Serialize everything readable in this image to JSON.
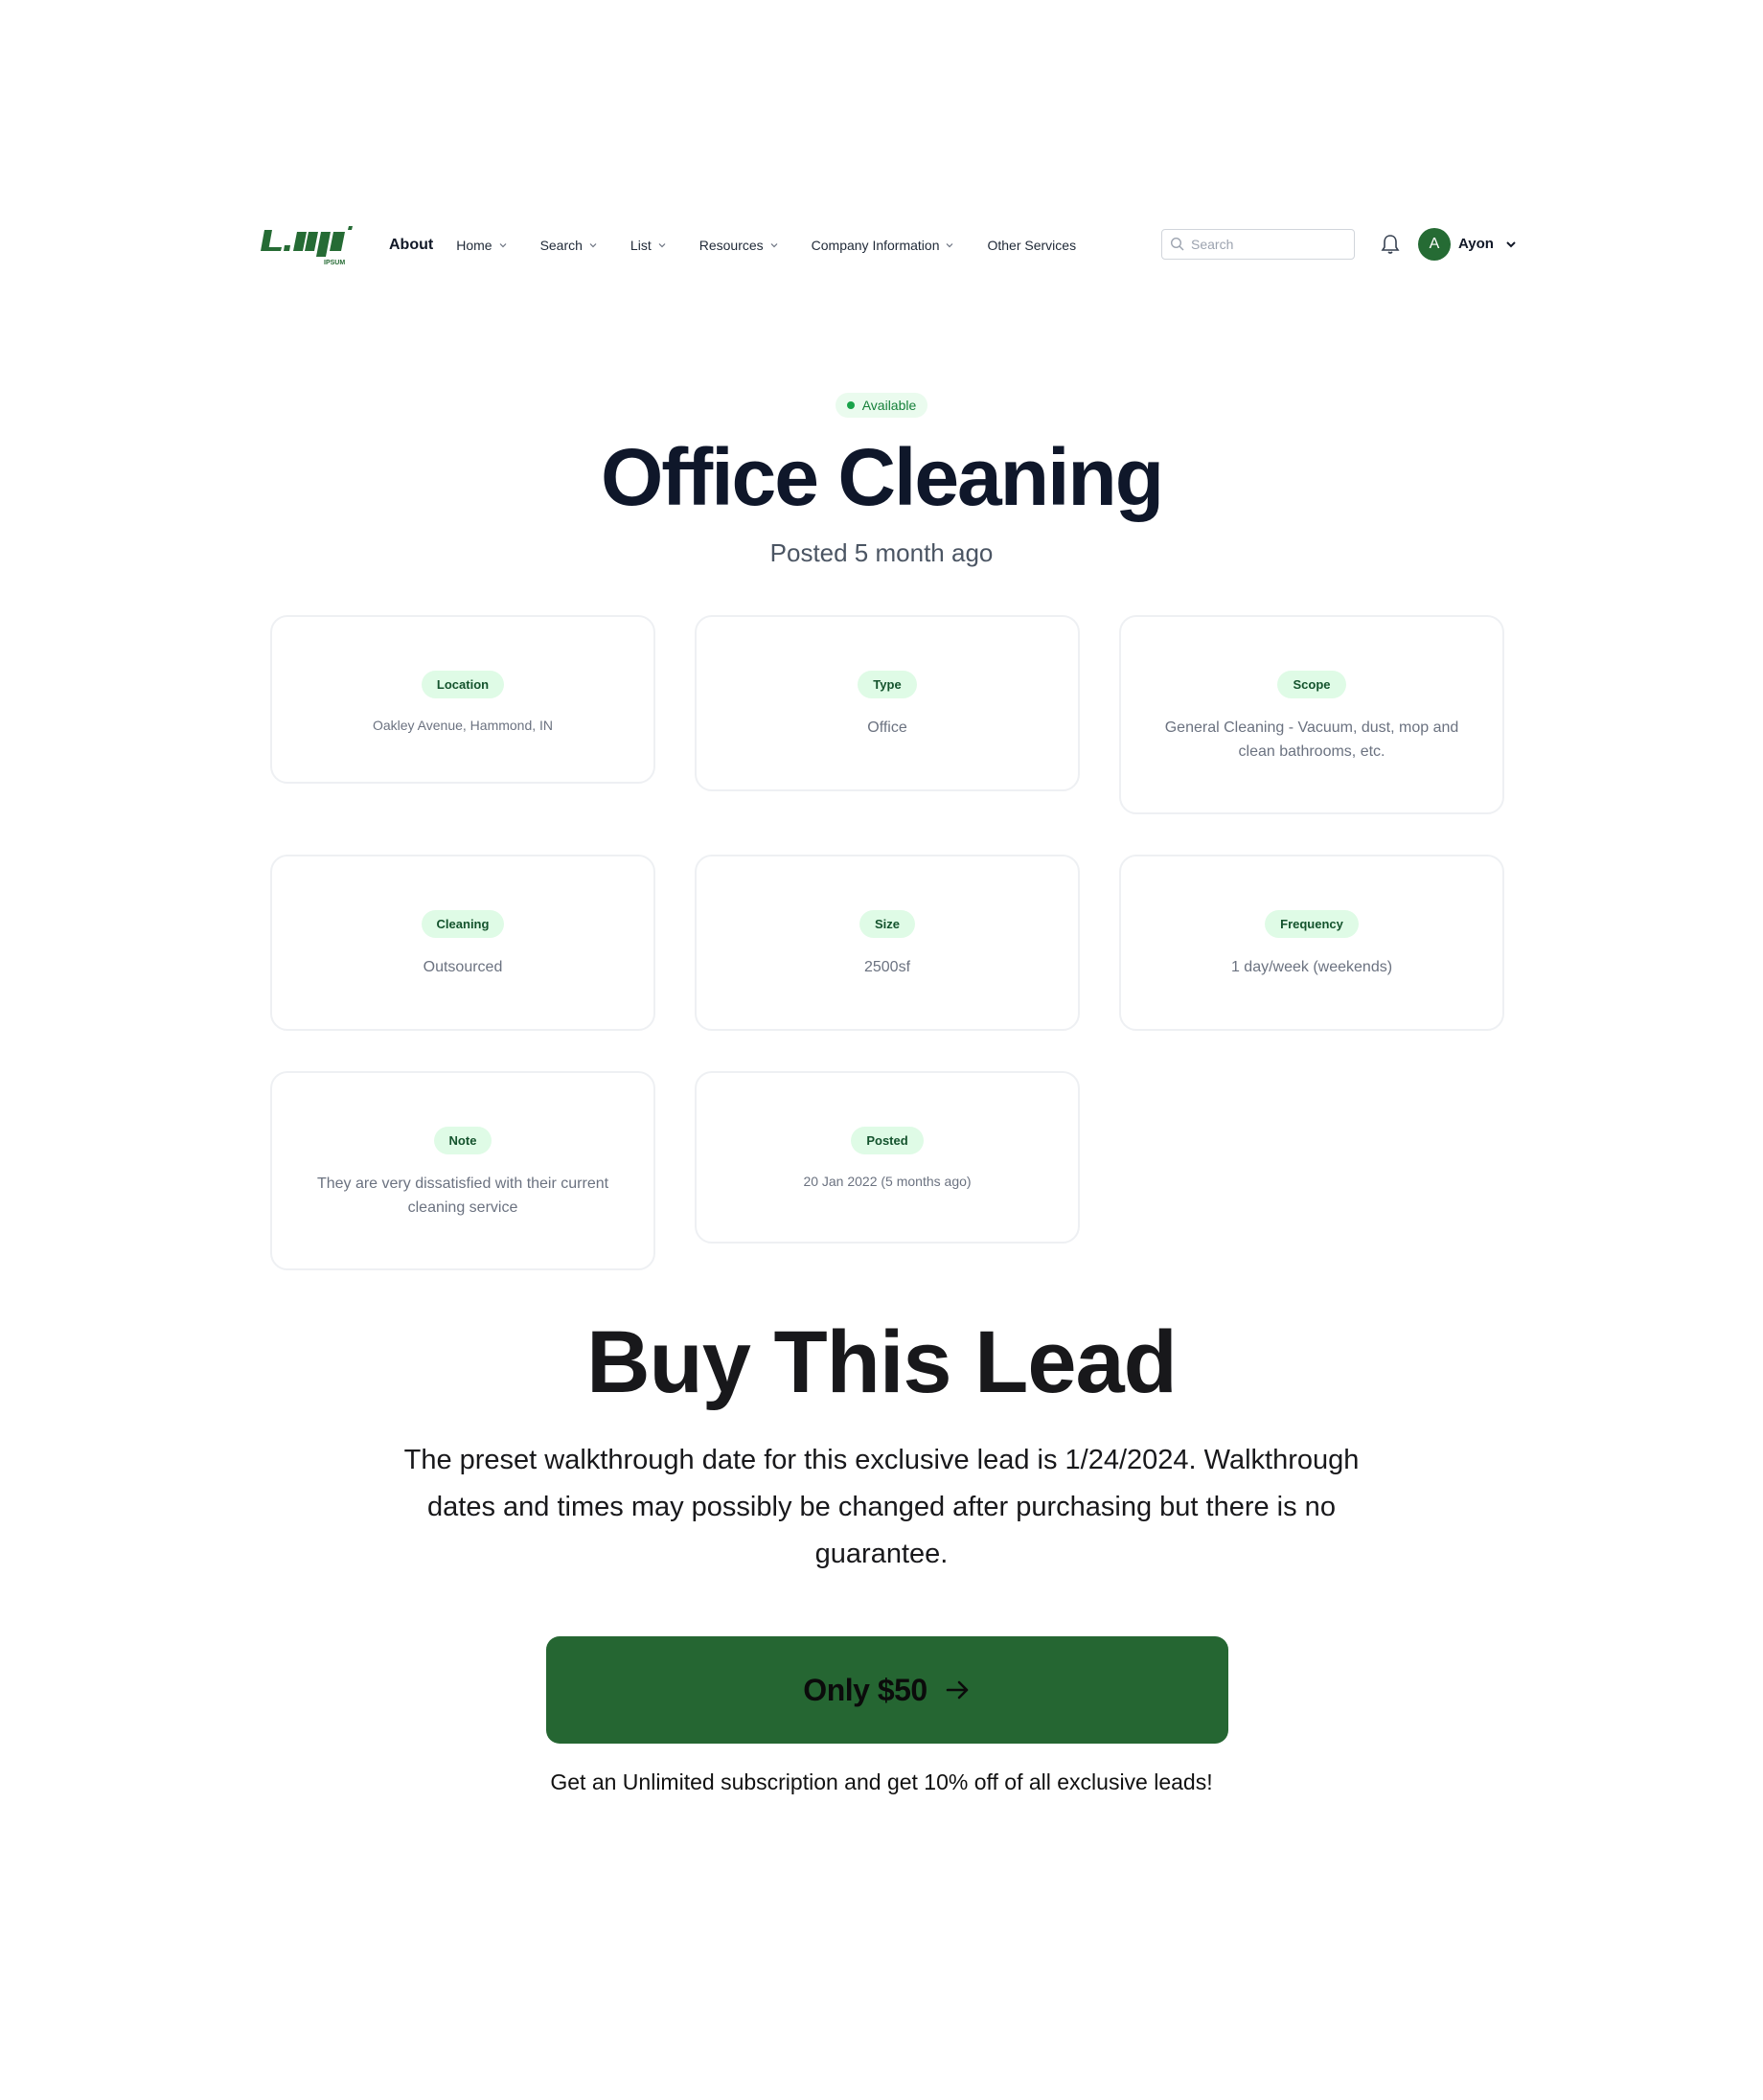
{
  "nav": {
    "logo_text": "Logo",
    "logo_subtext": "IPSUM",
    "items": [
      {
        "label": "About"
      },
      {
        "label": "Home"
      },
      {
        "label": "Search"
      },
      {
        "label": "List"
      },
      {
        "label": "Resources"
      },
      {
        "label": "Company Information"
      },
      {
        "label": "Other Services"
      }
    ],
    "search_placeholder": "Search",
    "user_initial": "A",
    "user_name": "Ayon"
  },
  "lead": {
    "status": "Available",
    "title": "Office Cleaning",
    "posted_ago": "Posted 5 month ago",
    "details": [
      {
        "label": "Location",
        "value": "Oakley Avenue, Hammond, IN"
      },
      {
        "label": "Type",
        "value": "Office"
      },
      {
        "label": "Scope",
        "value": "General Cleaning - Vacuum, dust, mop and clean bathrooms, etc."
      },
      {
        "label": "Cleaning",
        "value": "Outsourced"
      },
      {
        "label": "Size",
        "value": "2500sf"
      },
      {
        "label": "Frequency",
        "value": "1 day/week (weekends)"
      },
      {
        "label": "Note",
        "value": "They are very dissatisfied with their current cleaning service"
      },
      {
        "label": "Posted",
        "value": "20 Jan 2022 (5 months ago)"
      }
    ]
  },
  "buy": {
    "title": "Buy This Lead",
    "description": "The preset walkthrough date for this exclusive lead is 1/24/2024. Walkthrough dates and times may possibly be changed after purchasing but there is no guarantee.",
    "cta_label": "Only $50",
    "promo": "Get an Unlimited subscription and get 10% off of all exclusive leads!"
  },
  "colors": {
    "brand_green": "#256632",
    "tag_bg": "#dffbe6",
    "status_green": "#19a34a"
  }
}
